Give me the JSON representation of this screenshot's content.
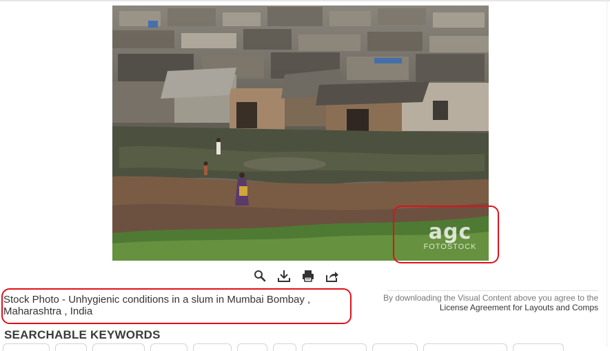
{
  "photo": {
    "watermark_logo": "agc",
    "watermark_logo_sub": "FOTOSTOCK"
  },
  "toolbar": {
    "icons": [
      "search-icon",
      "download-icon",
      "print-icon",
      "share-icon"
    ]
  },
  "caption": {
    "title": "Stock Photo - Unhygienic conditions in a slum in Mumbai Bombay , Maharashtra , India"
  },
  "license": {
    "line1": "By downloading the Visual Content above you agree to the",
    "line2": "License Agreement for Layouts and Comps"
  },
  "keywords": {
    "heading": "SEARCHABLE KEYWORDS"
  },
  "colors": {
    "highlight": "#e0101a",
    "icon": "#333333"
  }
}
